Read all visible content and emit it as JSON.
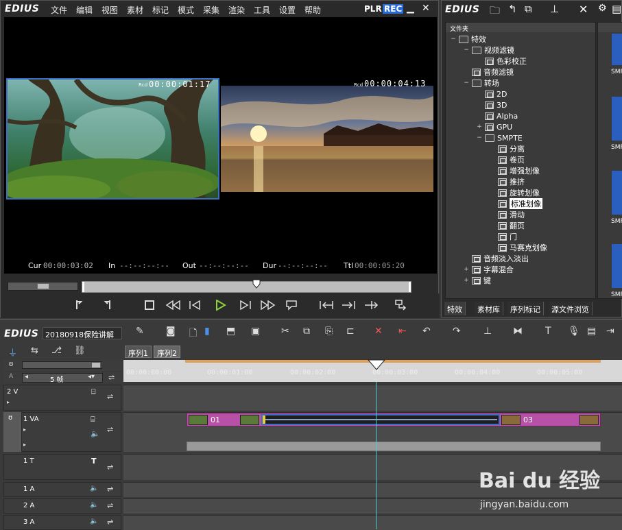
{
  "app_name": "EDIUS",
  "player": {
    "menu": [
      "文件",
      "编辑",
      "视图",
      "素材",
      "标记",
      "模式",
      "采集",
      "渲染",
      "工具",
      "设置",
      "帮助"
    ],
    "plr_label": "PLR",
    "rec_label": "REC",
    "left_rcd": "Rcd",
    "left_timecode": "00:00:01:17",
    "right_rcd": "Rcd",
    "right_timecode": "00:00:04:13",
    "cur_label": "Cur",
    "cur_value": "00:00:03:02",
    "in_label": "In",
    "in_value": "--:--:--:--",
    "out_label": "Out",
    "out_value": "--:--:--:--",
    "dur_label": "Dur",
    "dur_value": "--:--:--:--",
    "ttl_label": "Ttl",
    "ttl_value": "00:00:05:20"
  },
  "bin": {
    "title": "EDIUS",
    "folder_header": "文件夹",
    "tree": [
      {
        "label": "特效",
        "indent": 0,
        "type": "folder",
        "exp": "−"
      },
      {
        "label": "视频滤镜",
        "indent": 1,
        "type": "folder",
        "exp": "−"
      },
      {
        "label": "色彩校正",
        "indent": 2,
        "type": "item",
        "exp": ""
      },
      {
        "label": "音频滤镜",
        "indent": 1,
        "type": "item",
        "exp": ""
      },
      {
        "label": "转场",
        "indent": 1,
        "type": "folder",
        "exp": "−"
      },
      {
        "label": "2D",
        "indent": 2,
        "type": "item",
        "exp": ""
      },
      {
        "label": "3D",
        "indent": 2,
        "type": "item",
        "exp": ""
      },
      {
        "label": "Alpha",
        "indent": 2,
        "type": "item",
        "exp": ""
      },
      {
        "label": "GPU",
        "indent": 2,
        "type": "item",
        "exp": "+"
      },
      {
        "label": "SMPTE",
        "indent": 2,
        "type": "folder",
        "exp": "−"
      },
      {
        "label": "分离",
        "indent": 3,
        "type": "item",
        "exp": ""
      },
      {
        "label": "卷页",
        "indent": 3,
        "type": "item",
        "exp": ""
      },
      {
        "label": "增强划像",
        "indent": 3,
        "type": "item",
        "exp": ""
      },
      {
        "label": "推挤",
        "indent": 3,
        "type": "item",
        "exp": ""
      },
      {
        "label": "旋转划像",
        "indent": 3,
        "type": "item",
        "exp": ""
      },
      {
        "label": "标准划像",
        "indent": 3,
        "type": "item",
        "exp": "",
        "selected": true
      },
      {
        "label": "滑动",
        "indent": 3,
        "type": "item",
        "exp": ""
      },
      {
        "label": "翻页",
        "indent": 3,
        "type": "item",
        "exp": ""
      },
      {
        "label": "门",
        "indent": 3,
        "type": "item",
        "exp": ""
      },
      {
        "label": "马赛克划像",
        "indent": 3,
        "type": "item",
        "exp": ""
      },
      {
        "label": "音频淡入淡出",
        "indent": 1,
        "type": "item",
        "exp": ""
      },
      {
        "label": "字幕混合",
        "indent": 1,
        "type": "item",
        "exp": "+"
      },
      {
        "label": "键",
        "indent": 1,
        "type": "item",
        "exp": "+"
      }
    ],
    "thumb_labels": [
      "SMP",
      "SMP",
      "SMP",
      "SMP"
    ],
    "tabs": [
      "特效",
      "素材库",
      "序列标记",
      "源文件浏览"
    ]
  },
  "timeline": {
    "project_name": "20180918保险讲解",
    "sequence_tabs": [
      "序列1",
      "序列2"
    ],
    "zoom_value": "5 帧",
    "ruler": [
      "00:00:00:00",
      "00:00:01:00",
      "00:00:02:00",
      "00:00:03:00",
      "00:00:04:00",
      "00:00:05:00"
    ],
    "tracks": [
      {
        "name": "2 V"
      },
      {
        "name": "1 VA"
      },
      {
        "name": "1 T"
      },
      {
        "name": "1 A"
      },
      {
        "name": "2 A"
      },
      {
        "name": "3 A"
      }
    ],
    "clip_left_label": "01",
    "clip_right_label": "03"
  },
  "watermark": {
    "brand": "Bai du 经验",
    "url": "jingyan.baidu.com"
  }
}
